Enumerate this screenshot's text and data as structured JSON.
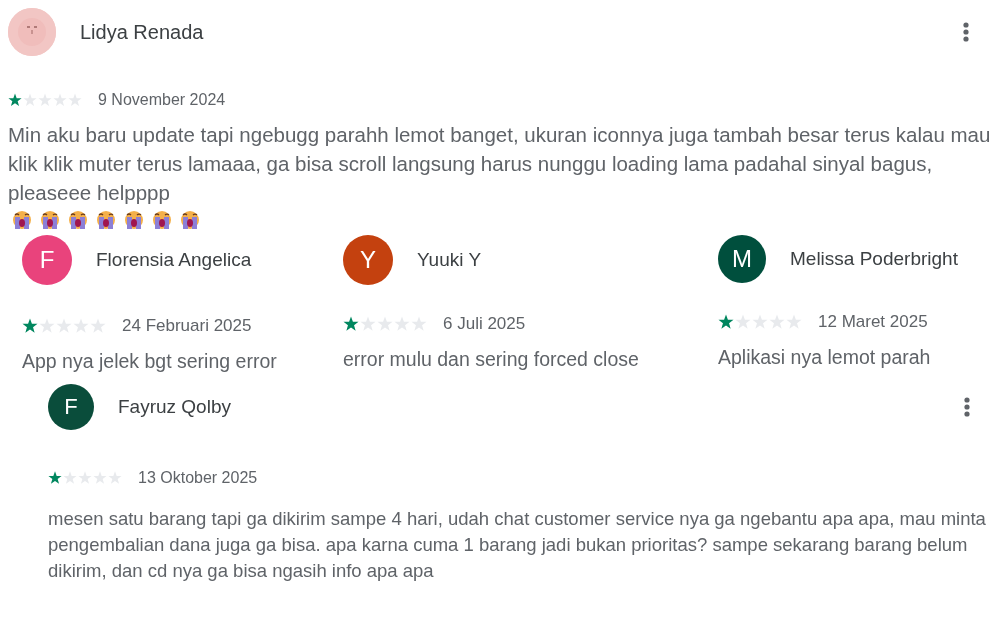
{
  "reviews": [
    {
      "author": "Lidya Renada",
      "menu": true,
      "stars": 1,
      "date": "9 November 2024",
      "text": "Min aku baru update tapi ngebugg parahh lemot banget, ukuran iconnya juga tambah besar terus kalau mau klik klik muter terus lamaaa, ga bisa scroll langsung harus nunggu loading lama padahal sinyal bagus, pleaseee helpppp",
      "emojis": [
        {
          "kind": "crying-face"
        },
        {
          "kind": "crying-face"
        },
        {
          "kind": "crying-face"
        },
        {
          "kind": "crying-face"
        },
        {
          "kind": "crying-face"
        },
        {
          "kind": "crying-face"
        },
        {
          "kind": "crying-face"
        }
      ]
    }
  ],
  "small_reviews": [
    {
      "author": "Florensia Angelica",
      "avatar": {
        "kind": "letter",
        "letter": "F",
        "color": "#e9437c"
      },
      "stars": 1,
      "date": "24 Februari 2025",
      "text": "App nya jelek bgt sering error"
    },
    {
      "author": "Yuuki Y",
      "avatar": {
        "kind": "letter",
        "letter": "Y",
        "color": "#c4410f"
      },
      "stars": 1,
      "date": "6 Juli 2025",
      "text": "error mulu dan sering forced close"
    },
    {
      "author": "Melissa Poderbright",
      "avatar": {
        "kind": "letter",
        "letter": "M",
        "color": "#004f3d"
      },
      "stars": 1,
      "date": "12 Maret 2025",
      "text": "Aplikasi nya lemot parah"
    }
  ],
  "last_review": {
    "author": "Fayruz Qolby",
    "avatar": {
      "kind": "letter",
      "letter": "F",
      "color": "#0a4d3b"
    },
    "menu": true,
    "stars": 1,
    "date": "13 Oktober 2025",
    "text": "mesen satu barang tapi ga dikirim sampe 4 hari, udah chat customer service nya ga ngebantu apa apa, mau minta pengembalian dana juga ga bisa. apa karna cuma 1 barang jadi bukan prioritas? sampe sekarang barang belum dikirim, dan cd nya ga bisa ngasih info apa apa"
  }
}
